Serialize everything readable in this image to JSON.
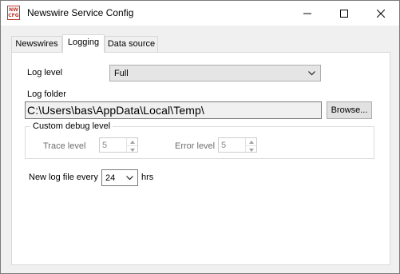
{
  "window": {
    "title": "Newswire Service Config",
    "icon_lines": [
      "NW",
      "CFG"
    ],
    "icons": {
      "app": "app-icon",
      "minimize": "minimize-icon",
      "maximize": "maximize-icon",
      "close": "close-icon"
    }
  },
  "tabs": [
    {
      "label": "Newswires",
      "active": false
    },
    {
      "label": "Logging",
      "active": true
    },
    {
      "label": "Data source",
      "active": false
    }
  ],
  "logging": {
    "log_level_label": "Log level",
    "log_level_value": "Full",
    "log_folder_label": "Log folder",
    "log_folder_value": "C:\\Users\\bas\\AppData\\Local\\Temp\\",
    "browse_label": "Browse...",
    "custom_debug_title": "Custom debug level",
    "trace_level_label": "Trace level",
    "trace_level_value": "5",
    "error_level_label": "Error level",
    "error_level_value": "5",
    "new_log_file_label": "New log file every",
    "new_log_file_value": "24",
    "hrs_label": "hrs"
  },
  "colors": {
    "titlebar": "#ffffff",
    "window_bg": "#f0f0f0",
    "panel_bg": "#ffffff",
    "icon_accent": "#c0392b",
    "disabled_text": "#6d6d6d"
  }
}
